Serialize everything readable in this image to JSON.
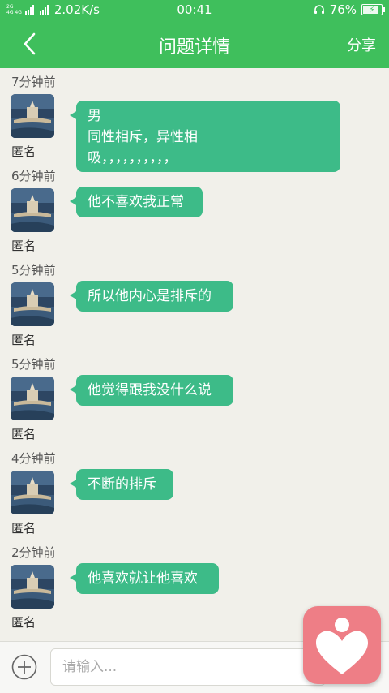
{
  "status_bar": {
    "network_top": "2G",
    "network_mid": "4G 4G",
    "speed": "2.02K/s",
    "time": "00:41",
    "battery": "76%"
  },
  "nav": {
    "title": "问题详情",
    "share": "分享"
  },
  "messages": [
    {
      "time": "7分钟前",
      "sender": "匿名",
      "text": "男\n同性相斥，异性相\n吸，，，，，，，，，，"
    },
    {
      "time": "6分钟前",
      "sender": "匿名",
      "text": "他不喜欢我正常"
    },
    {
      "time": "5分钟前",
      "sender": "匿名",
      "text": "所以他内心是排斥的"
    },
    {
      "time": "5分钟前",
      "sender": "匿名",
      "text": "他觉得跟我没什么说"
    },
    {
      "time": "4分钟前",
      "sender": "匿名",
      "text": "不断的排斥"
    },
    {
      "time": "2分钟前",
      "sender": "匿名",
      "text": "他喜欢就让他喜欢"
    }
  ],
  "input": {
    "placeholder": "请输入..."
  },
  "colors": {
    "brand": "#3fbf5c",
    "bubble": "#3dbb88",
    "float_button": "#ee7e86"
  }
}
